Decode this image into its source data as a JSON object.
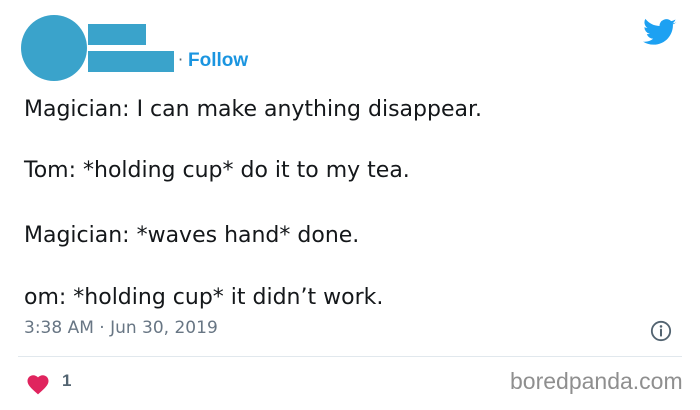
{
  "header": {
    "follow_separator": "·",
    "follow_label": "Follow"
  },
  "tweet": {
    "lines": [
      "Magician: I can make anything disappear.",
      "Tom: *holding cup* do it to my tea.",
      "Magician: *waves hand* done.",
      "om: *holding cup* it didn’t work."
    ],
    "timestamp": "3:38 AM · Jun 30, 2019"
  },
  "actions": {
    "like_count": "1"
  },
  "watermark": "boredpanda.com",
  "colors": {
    "avatar_placeholder": "#3aa3cb",
    "follow_link": "#1b95e0",
    "twitter_blue": "#1da1f2",
    "heart": "#e0245e"
  },
  "icons": {
    "brand": "twitter-bird-icon",
    "info": "info-icon",
    "like": "heart-icon"
  }
}
